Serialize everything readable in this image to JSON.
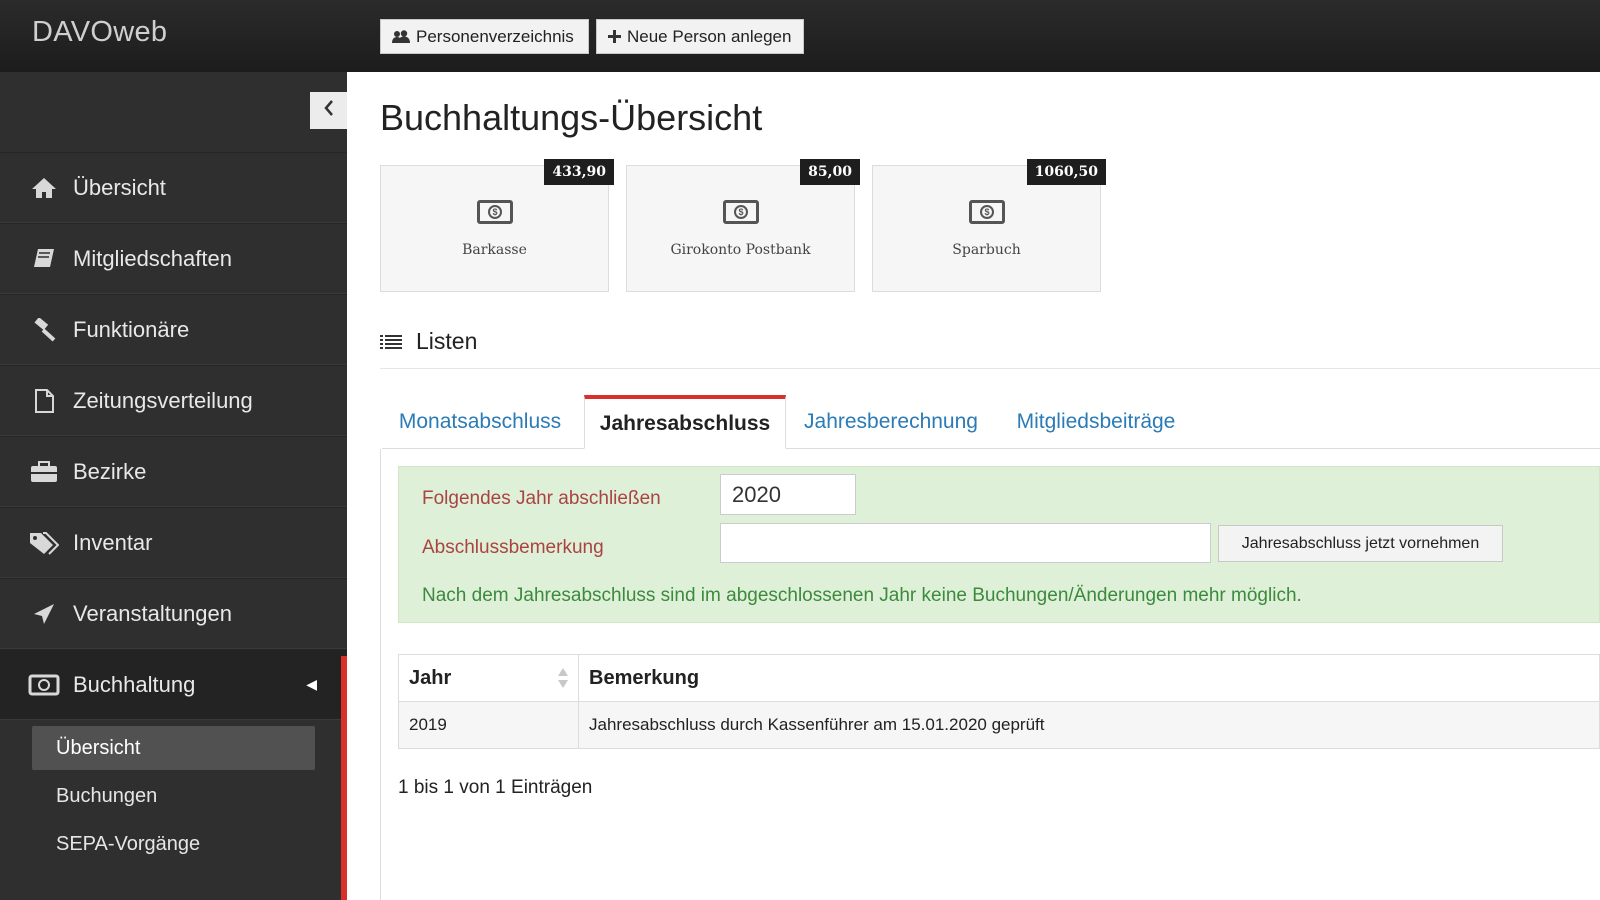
{
  "app": {
    "brand": "DAVOweb"
  },
  "topbar": {
    "buttons": [
      {
        "label": "Personenverzeichnis",
        "icon": "users-icon"
      },
      {
        "label": "Neue Person anlegen",
        "icon": "plus-icon"
      }
    ]
  },
  "sidebar": {
    "collapse_icon": "chevron-left-icon",
    "items": [
      {
        "label": "Übersicht",
        "icon": "home-icon"
      },
      {
        "label": "Mitgliedschaften",
        "icon": "book-icon"
      },
      {
        "label": "Funktionäre",
        "icon": "gavel-icon"
      },
      {
        "label": "Zeitungsverteilung",
        "icon": "file-icon"
      },
      {
        "label": "Bezirke",
        "icon": "briefcase-icon"
      },
      {
        "label": "Inventar",
        "icon": "tags-icon"
      },
      {
        "label": "Veranstaltungen",
        "icon": "plane-icon"
      },
      {
        "label": "Buchhaltung",
        "icon": "money-icon",
        "active": true
      }
    ],
    "subitems": [
      {
        "label": "Übersicht",
        "active": true
      },
      {
        "label": "Buchungen"
      },
      {
        "label": "SEPA-Vorgänge"
      }
    ]
  },
  "main": {
    "title": "Buchhaltungs-Übersicht",
    "accounts": [
      {
        "name": "Barkasse",
        "balance": "433,90"
      },
      {
        "name": "Girokonto Postbank",
        "balance": "85,00"
      },
      {
        "name": "Sparbuch",
        "balance": "1060,50"
      }
    ],
    "lists_heading": "Listen",
    "tabs": [
      {
        "label": "Monatsabschluss"
      },
      {
        "label": "Jahresabschluss",
        "active": true
      },
      {
        "label": "Jahresberechnung"
      },
      {
        "label": "Mitgliedsbeiträge"
      }
    ],
    "form": {
      "year_label": "Folgendes Jahr abschließen",
      "year_value": "2020",
      "note_label": "Abschlussbemerkung",
      "note_value": "",
      "submit_label": "Jahresabschluss jetzt vornehmen",
      "hint": "Nach dem Jahresabschluss sind im abgeschlossenen Jahr keine Buchungen/Änderungen mehr möglich."
    },
    "table": {
      "columns": [
        "Jahr",
        "Bemerkung"
      ],
      "rows": [
        {
          "jahr": "2019",
          "bemerkung": "Jahresabschluss durch Kassenführer am 15.01.2020 geprüft"
        }
      ],
      "info": "1 bis 1 von 1 Einträgen"
    }
  },
  "colors": {
    "accent_red": "#d9302c",
    "link_blue": "#2a7bb6",
    "success_bg": "#dff0d8",
    "label_red": "#a94442",
    "hint_green": "#3c8a3c"
  }
}
